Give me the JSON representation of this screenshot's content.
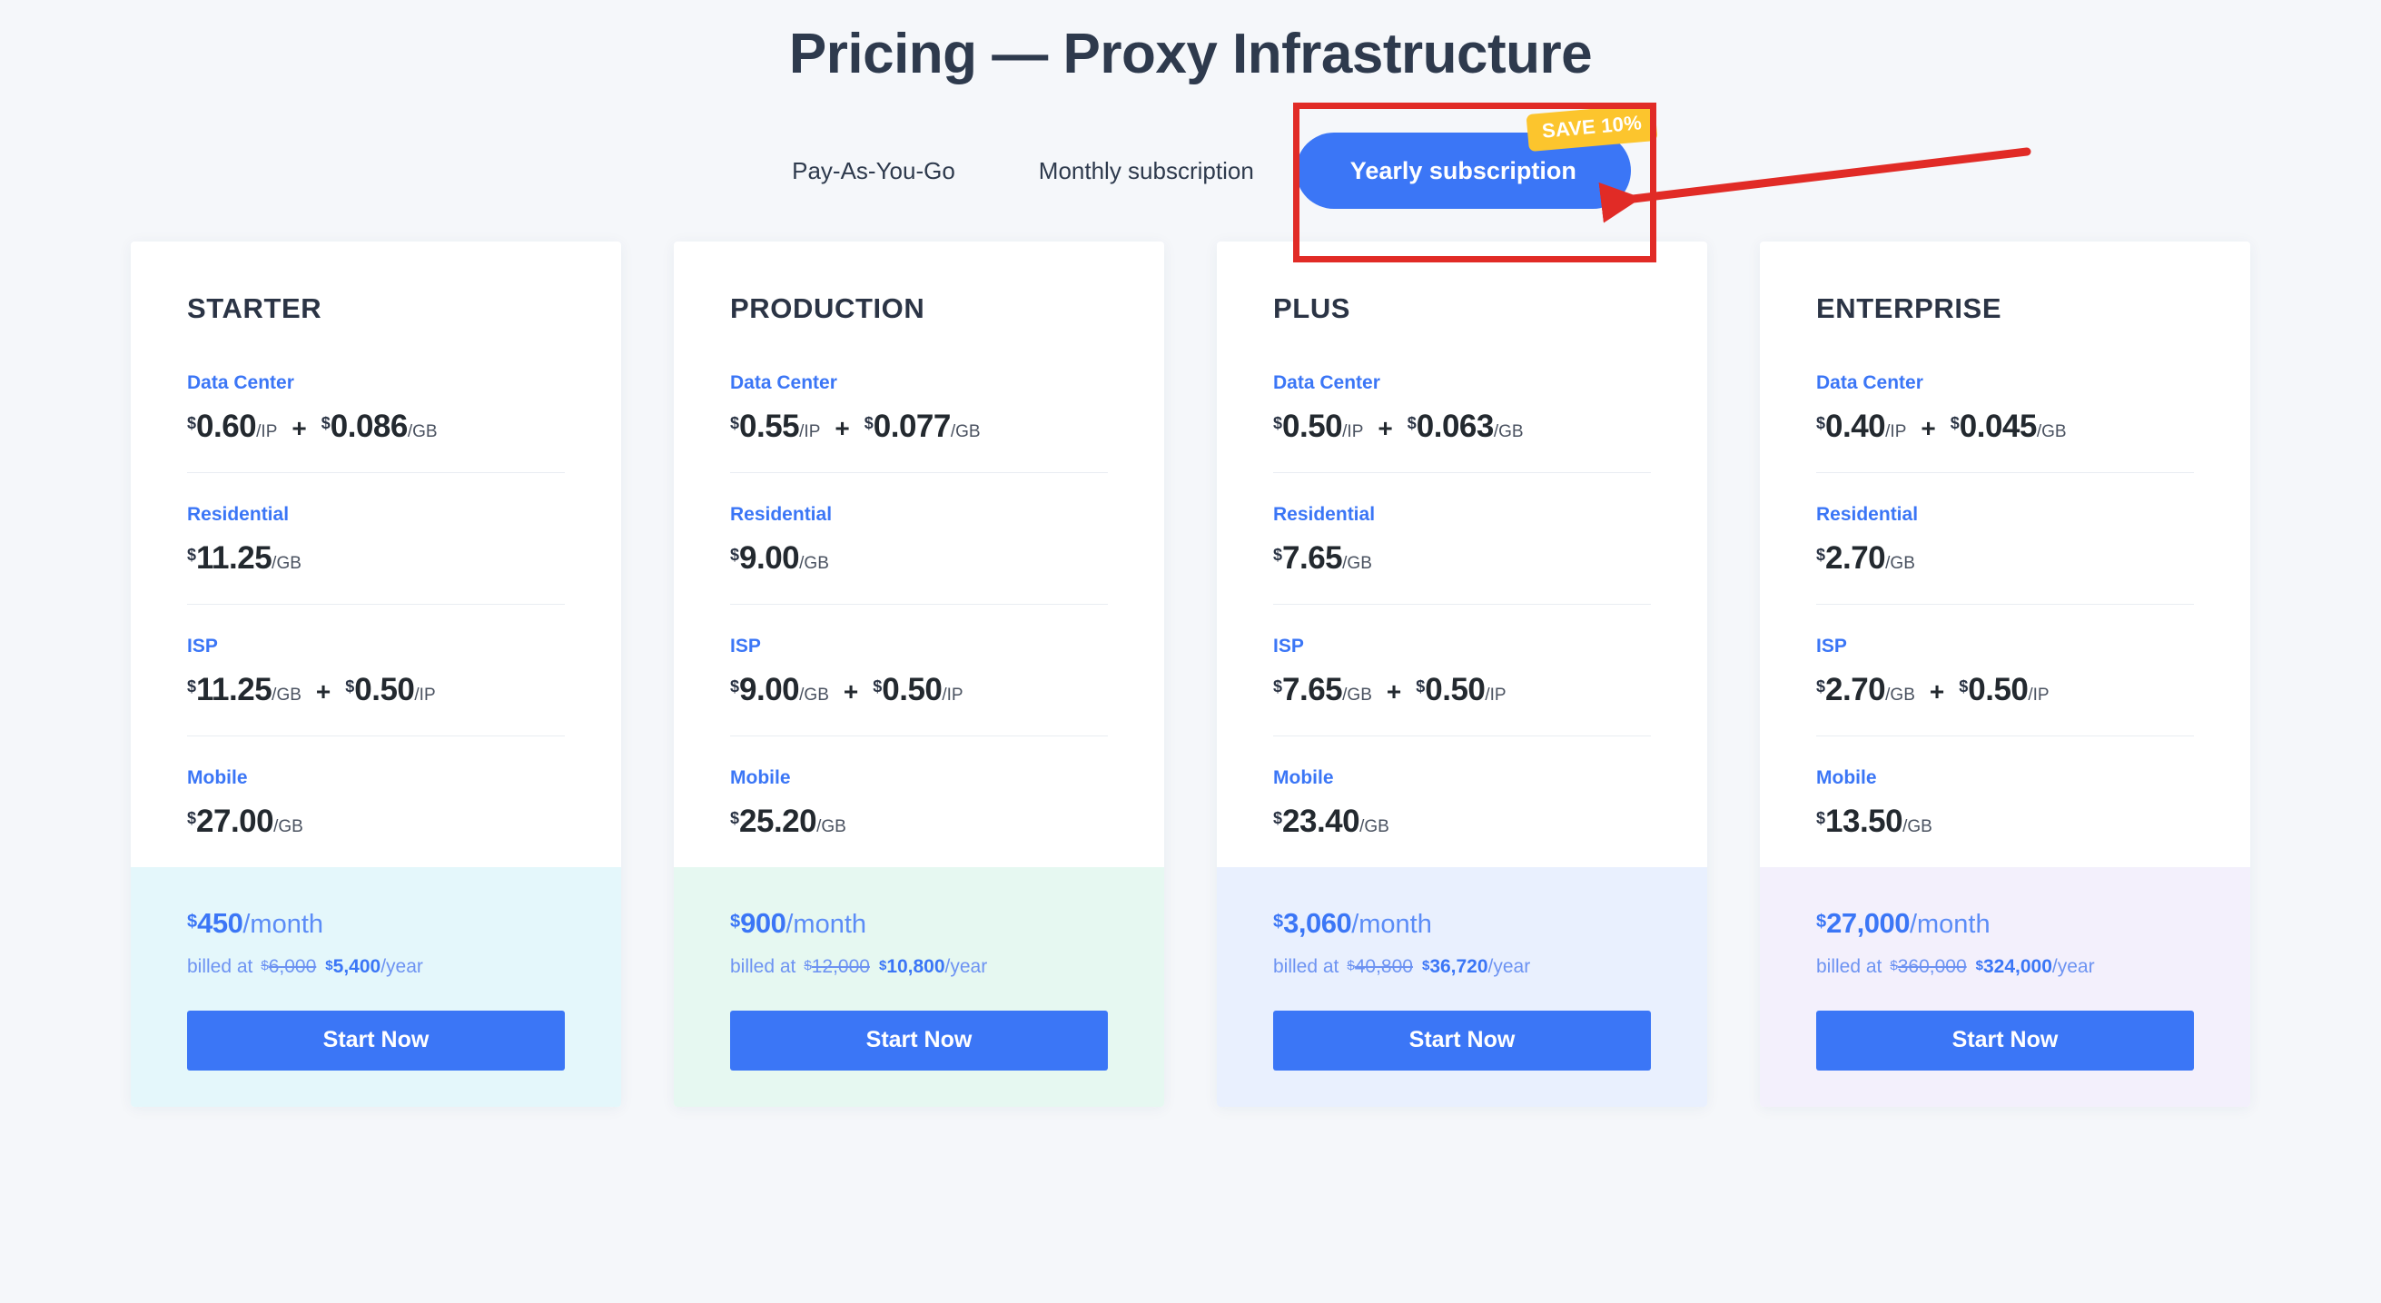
{
  "page": {
    "title": "Pricing — Proxy Infrastructure",
    "background_color": "#f5f7fa",
    "accent_color": "#3b76f6",
    "badge_color": "#fcc52d",
    "annotation_color": "#e12b26"
  },
  "billing": {
    "tabs": [
      {
        "label": "Pay-As-You-Go",
        "active": false
      },
      {
        "label": "Monthly subscription",
        "active": false
      },
      {
        "label": "Yearly subscription",
        "active": true,
        "badge": "SAVE 10%"
      }
    ]
  },
  "cards": [
    {
      "title": "STARTER",
      "tint": "tint-0",
      "rows": [
        {
          "label": "Data Center",
          "prices": [
            {
              "currency": "$",
              "amount": "0.60",
              "unit": "/IP"
            },
            {
              "currency": "$",
              "amount": "0.086",
              "unit": "/GB"
            }
          ]
        },
        {
          "label": "Residential",
          "prices": [
            {
              "currency": "$",
              "amount": "11.25",
              "unit": "/GB"
            }
          ]
        },
        {
          "label": "ISP",
          "prices": [
            {
              "currency": "$",
              "amount": "11.25",
              "unit": "/GB"
            },
            {
              "currency": "$",
              "amount": "0.50",
              "unit": "/IP"
            }
          ]
        },
        {
          "label": "Mobile",
          "prices": [
            {
              "currency": "$",
              "amount": "27.00",
              "unit": "/GB"
            }
          ]
        }
      ],
      "monthly": {
        "currency": "$",
        "amount": "450",
        "period": "/month"
      },
      "billed": {
        "prefix": "billed at",
        "old_currency": "$",
        "old_amount": "6,000",
        "new_currency": "$",
        "new_amount": "5,400",
        "period": "/year"
      },
      "cta": "Start Now"
    },
    {
      "title": "PRODUCTION",
      "tint": "tint-1",
      "rows": [
        {
          "label": "Data Center",
          "prices": [
            {
              "currency": "$",
              "amount": "0.55",
              "unit": "/IP"
            },
            {
              "currency": "$",
              "amount": "0.077",
              "unit": "/GB"
            }
          ]
        },
        {
          "label": "Residential",
          "prices": [
            {
              "currency": "$",
              "amount": "9.00",
              "unit": "/GB"
            }
          ]
        },
        {
          "label": "ISP",
          "prices": [
            {
              "currency": "$",
              "amount": "9.00",
              "unit": "/GB"
            },
            {
              "currency": "$",
              "amount": "0.50",
              "unit": "/IP"
            }
          ]
        },
        {
          "label": "Mobile",
          "prices": [
            {
              "currency": "$",
              "amount": "25.20",
              "unit": "/GB"
            }
          ]
        }
      ],
      "monthly": {
        "currency": "$",
        "amount": "900",
        "period": "/month"
      },
      "billed": {
        "prefix": "billed at",
        "old_currency": "$",
        "old_amount": "12,000",
        "new_currency": "$",
        "new_amount": "10,800",
        "period": "/year"
      },
      "cta": "Start Now"
    },
    {
      "title": "PLUS",
      "tint": "tint-2",
      "rows": [
        {
          "label": "Data Center",
          "prices": [
            {
              "currency": "$",
              "amount": "0.50",
              "unit": "/IP"
            },
            {
              "currency": "$",
              "amount": "0.063",
              "unit": "/GB"
            }
          ]
        },
        {
          "label": "Residential",
          "prices": [
            {
              "currency": "$",
              "amount": "7.65",
              "unit": "/GB"
            }
          ]
        },
        {
          "label": "ISP",
          "prices": [
            {
              "currency": "$",
              "amount": "7.65",
              "unit": "/GB"
            },
            {
              "currency": "$",
              "amount": "0.50",
              "unit": "/IP"
            }
          ]
        },
        {
          "label": "Mobile",
          "prices": [
            {
              "currency": "$",
              "amount": "23.40",
              "unit": "/GB"
            }
          ]
        }
      ],
      "monthly": {
        "currency": "$",
        "amount": "3,060",
        "period": "/month"
      },
      "billed": {
        "prefix": "billed at",
        "old_currency": "$",
        "old_amount": "40,800",
        "new_currency": "$",
        "new_amount": "36,720",
        "period": "/year"
      },
      "cta": "Start Now"
    },
    {
      "title": "ENTERPRISE",
      "tint": "tint-3",
      "rows": [
        {
          "label": "Data Center",
          "prices": [
            {
              "currency": "$",
              "amount": "0.40",
              "unit": "/IP"
            },
            {
              "currency": "$",
              "amount": "0.045",
              "unit": "/GB"
            }
          ]
        },
        {
          "label": "Residential",
          "prices": [
            {
              "currency": "$",
              "amount": "2.70",
              "unit": "/GB"
            }
          ]
        },
        {
          "label": "ISP",
          "prices": [
            {
              "currency": "$",
              "amount": "2.70",
              "unit": "/GB"
            },
            {
              "currency": "$",
              "amount": "0.50",
              "unit": "/IP"
            }
          ]
        },
        {
          "label": "Mobile",
          "prices": [
            {
              "currency": "$",
              "amount": "13.50",
              "unit": "/GB"
            }
          ]
        }
      ],
      "monthly": {
        "currency": "$",
        "amount": "27,000",
        "period": "/month"
      },
      "billed": {
        "prefix": "billed at",
        "old_currency": "$",
        "old_amount": "360,000",
        "new_currency": "$",
        "new_amount": "324,000",
        "period": "/year"
      },
      "cta": "Start Now"
    }
  ],
  "plus_symbol": "+"
}
